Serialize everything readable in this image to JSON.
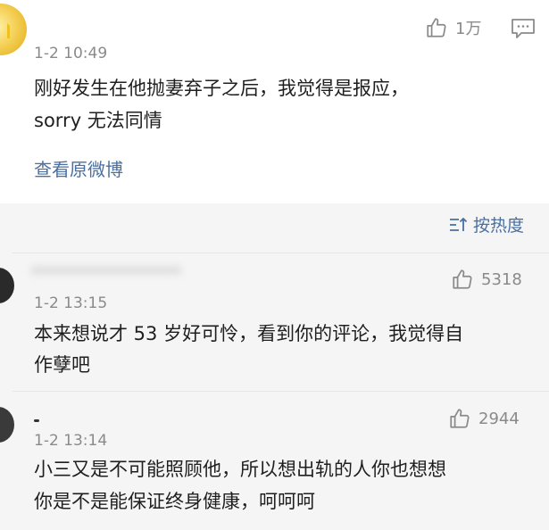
{
  "main_comment": {
    "time": "1-2 10:49",
    "like_count": "1万",
    "content_line1": "刚好发生在他抛妻弃子之后，我觉得是报应，",
    "content_line2": "sorry 无法同情",
    "view_original_label": "查看原微博"
  },
  "replies_header": {
    "sort_label": "按热度"
  },
  "replies": [
    {
      "time": "1-2 13:15",
      "like_count": "5318",
      "content_line1": "本来想说才 53 岁好可怜，看到你的评论，我觉得自",
      "content_line2": "作孽吧"
    },
    {
      "time": "1-2 13:14",
      "like_count": "2944",
      "content_line1": "小三又是不可能照顾他，所以想出轨的人你也想想",
      "content_line2": "你是不是能保证终身健康，呵呵呵"
    }
  ],
  "colors": {
    "link": "#4a6fa0",
    "meta": "#8a8a8a",
    "reply_bg": "#f5f5f5"
  },
  "icons": [
    "thumbs-up-icon",
    "comment-icon",
    "sort-icon"
  ]
}
